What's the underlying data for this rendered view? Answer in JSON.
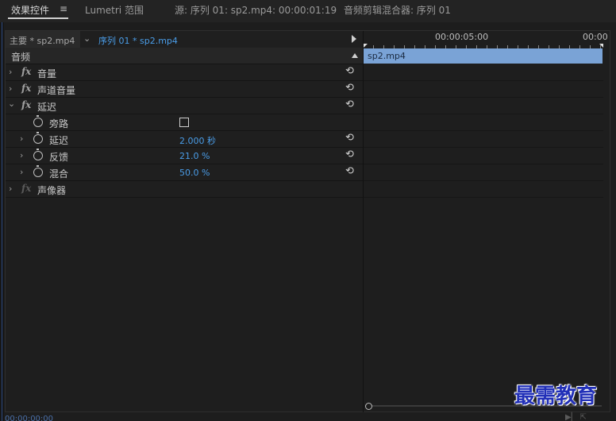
{
  "tabs": [
    {
      "label": "效果控件",
      "active": true
    },
    {
      "label": "Lumetri 范围",
      "active": false
    },
    {
      "label": "源: 序列 01: sp2.mp4: 00:00:01:19",
      "active": false
    },
    {
      "label": "音频剪辑混合器: 序列 01",
      "active": false
    }
  ],
  "menu_icon": "≡",
  "clip_selector": {
    "master": "主要 * sp2.mp4",
    "sequence": "序列 01 * sp2.mp4"
  },
  "section": {
    "label": "音频"
  },
  "effects": [
    {
      "label": "音量",
      "fx": "fx",
      "expanded": false
    },
    {
      "label": "声道音量",
      "fx": "fx",
      "expanded": false
    },
    {
      "label": "延迟",
      "fx": "fx",
      "expanded": true
    }
  ],
  "params": [
    {
      "label": "旁路",
      "type": "checkbox",
      "checked": false
    },
    {
      "label": "延迟",
      "type": "value",
      "value": "2.000 秒"
    },
    {
      "label": "反馈",
      "type": "value",
      "value": "21.0 %"
    },
    {
      "label": "混合",
      "type": "value",
      "value": "50.0 %"
    }
  ],
  "disabled_effect": {
    "label": "声像器",
    "fx": "fx"
  },
  "timeline": {
    "timecode_1": "00:00:05:00",
    "timecode_2": "00:00",
    "clip_name": "sp2.mp4"
  },
  "bottom": {
    "timecode": "00:00:00:00"
  },
  "watermark": "最需教育",
  "colors": {
    "accent_blue": "#4a9de8",
    "clip_blue": "#7aa3d6",
    "watermark": "#2230b8"
  }
}
